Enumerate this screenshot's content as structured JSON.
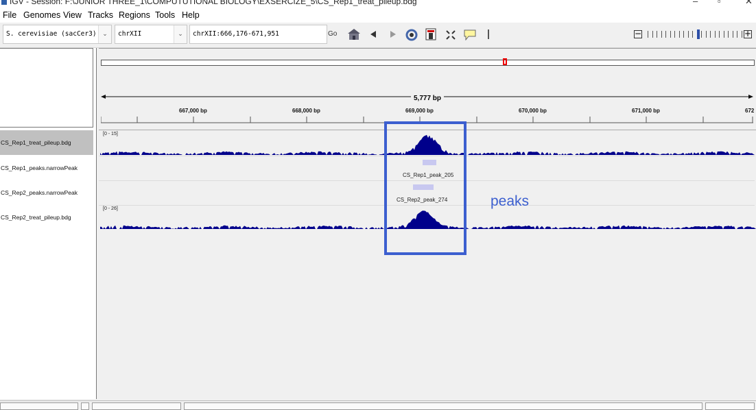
{
  "window": {
    "title": "IGV - Session: F:\\JUNIOR THREE_1\\COMPUTUTIONAL BIOLOGY\\EXSERCIZE_5\\CS_Rep1_treat_pileup.bdg"
  },
  "menu": [
    "File",
    "Genomes",
    "View",
    "Tracks",
    "Regions",
    "Tools",
    "Help"
  ],
  "toolbar": {
    "genome": "S. cerevisiae (sacCer3)",
    "chromosome": "chrXII",
    "locus": "chrXII:666,176-671,951",
    "go_label": "Go"
  },
  "ruler": {
    "span": "5,777 bp",
    "ticks": [
      "667,000 bp",
      "668,000 bp",
      "669,000 bp",
      "670,000 bp",
      "671,000 bp",
      "672"
    ]
  },
  "tracks": [
    {
      "name": "CS_Rep1_treat_pileup.bdg",
      "range": "[0 - 15]"
    },
    {
      "name": "CS_Rep1_peaks.narrowPeak",
      "feature": "CS_Rep1_peak_205"
    },
    {
      "name": "CS_Rep2_peaks.narrowPeak",
      "feature": "CS_Rep2_peak_274"
    },
    {
      "name": "CS_Rep2_treat_pileup.bdg",
      "range": "[0 - 26]"
    }
  ],
  "annotation": {
    "text": "peaks"
  },
  "colors": {
    "signal": "#00008b",
    "peak_feature": "#c8c8f0",
    "annotation": "#3c5fcf",
    "viewbox": "#e00000"
  }
}
